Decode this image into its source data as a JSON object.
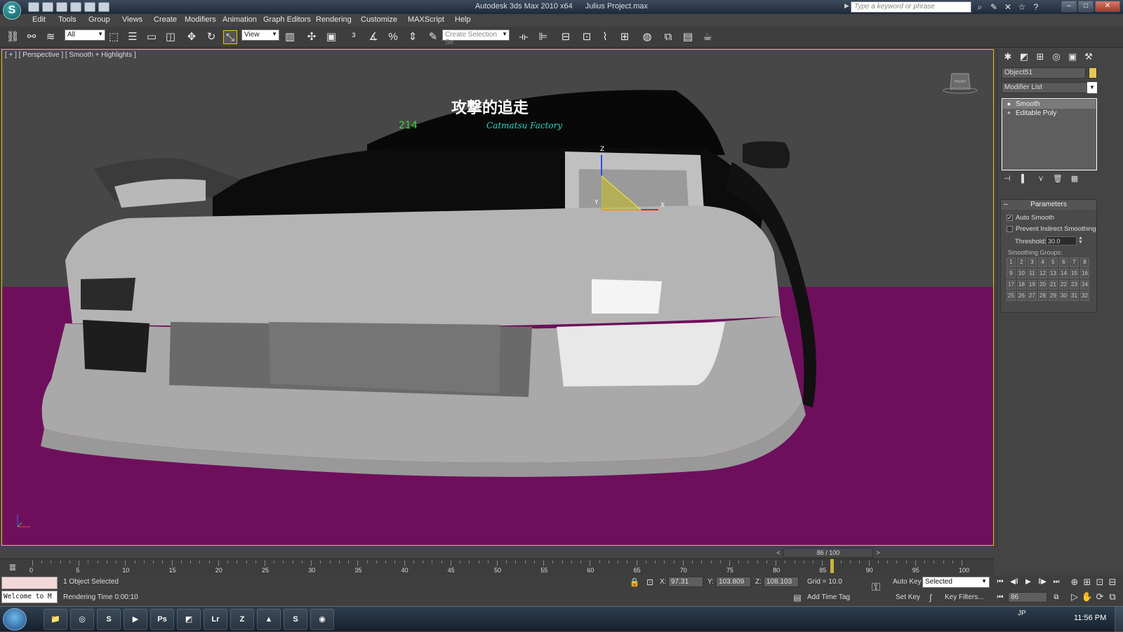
{
  "window": {
    "title": "Autodesk 3ds Max  2010 x64",
    "file": "Julius Project.max",
    "search_placeholder": "Type a keyword or phrase"
  },
  "menu": [
    "Edit",
    "Tools",
    "Group",
    "Views",
    "Create",
    "Modifiers",
    "Animation",
    "Graph Editors",
    "Rendering",
    "Customize",
    "MAXScript",
    "Help"
  ],
  "toolbar": {
    "selection_filter": "All",
    "reference_coord": "View",
    "named_selection_placeholder": "Create Selection Se"
  },
  "viewport": {
    "label": "[ + ] [ Perspective ] [ Smooth + Highlights ]",
    "viewcube_face": "FRONT",
    "windshield_banner": "攻撃的追走",
    "windshield_sub": "Catmatsu Factory",
    "windshield_number": "214",
    "gizmo_axes": [
      "Z",
      "X",
      "Y"
    ],
    "ground_color": "#6e0f5c",
    "active_border_color": "#e6c40a"
  },
  "command_panel": {
    "object_name": "Object51",
    "object_color": "#e6c552",
    "modifier_list_label": "Modifier List",
    "stack": [
      {
        "label": "Smooth",
        "selected": true
      },
      {
        "label": "Editable Poly",
        "selected": false
      }
    ],
    "parameters": {
      "title": "Parameters",
      "auto_smooth_label": "Auto Smooth",
      "auto_smooth_checked": true,
      "prevent_indirect_label": "Prevent Indirect Smoothing",
      "prevent_indirect_checked": false,
      "threshold_label": "Threshold:",
      "threshold_value": "30.0",
      "smoothing_groups_label": "Smoothing Groups:",
      "smoothing_groups": [
        "1",
        "2",
        "3",
        "4",
        "5",
        "6",
        "7",
        "8",
        "9",
        "10",
        "11",
        "12",
        "13",
        "14",
        "15",
        "16",
        "17",
        "18",
        "19",
        "20",
        "21",
        "22",
        "23",
        "24",
        "25",
        "26",
        "27",
        "28",
        "29",
        "30",
        "31",
        "32"
      ]
    }
  },
  "timeline": {
    "slider_label": "86 / 100",
    "current_frame": 86,
    "max_frame": 100,
    "ticks": [
      "0",
      "5",
      "10",
      "15",
      "20",
      "25",
      "30",
      "35",
      "40",
      "45",
      "50",
      "55",
      "60",
      "65",
      "70",
      "75",
      "80",
      "85",
      "90",
      "95",
      "100"
    ]
  },
  "status": {
    "selection": "1 Object Selected",
    "prompt": "Rendering Time  0:00:10",
    "welcome": "Welcome to M",
    "x_label": "X:",
    "x_value": "97.31",
    "y_label": "Y:",
    "y_value": "103.809",
    "z_label": "Z:",
    "z_value": "108.103",
    "grid": "Grid = 10.0",
    "add_time_tag": "Add Time Tag",
    "auto_key": "Auto Key",
    "set_key": "Set Key",
    "key_mode": "Selected",
    "key_filters": "Key Filters...",
    "frame_value": "86"
  },
  "taskbar": {
    "apps": [
      {
        "name": "explorer",
        "glyph": "📁"
      },
      {
        "name": "chrome",
        "glyph": "◎"
      },
      {
        "name": "3dsmax",
        "glyph": "S"
      },
      {
        "name": "media-player",
        "glyph": "▶"
      },
      {
        "name": "photoshop",
        "glyph": "Ps"
      },
      {
        "name": "program",
        "glyph": "◩"
      },
      {
        "name": "lightroom",
        "glyph": "Lr"
      },
      {
        "name": "app-orange",
        "glyph": "Z"
      },
      {
        "name": "photo-viewer",
        "glyph": "▲"
      },
      {
        "name": "skype",
        "glyph": "S"
      },
      {
        "name": "firefox",
        "glyph": "◉"
      }
    ],
    "lang": "JP",
    "clock": "11:56 PM"
  }
}
